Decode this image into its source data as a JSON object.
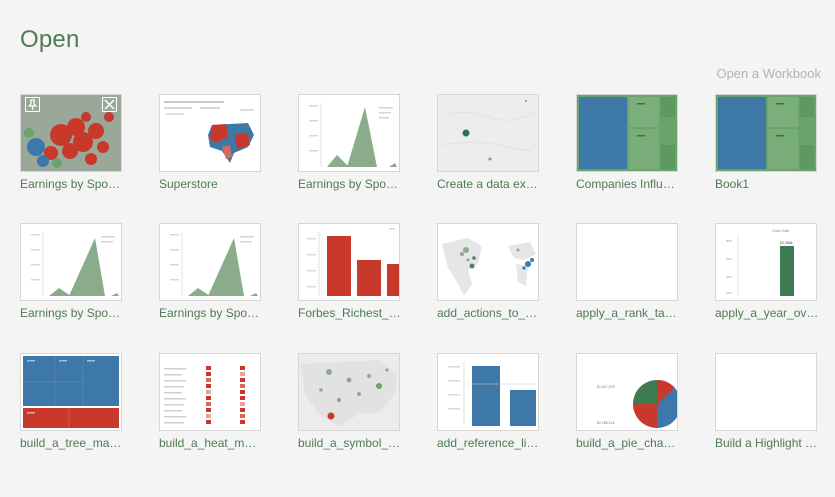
{
  "header": {
    "title": "Open",
    "open_workbook": "Open a Workbook"
  },
  "workbooks": [
    {
      "label": "Earnings by Spo…",
      "thumb": "bubbles-hover"
    },
    {
      "label": "Superstore",
      "thumb": "map-dashboard"
    },
    {
      "label": "Earnings by Spo…",
      "thumb": "area-peak"
    },
    {
      "label": "Create a data ex…",
      "thumb": "map-dots"
    },
    {
      "label": "Companies Influ…",
      "thumb": "treemap-blue-green"
    },
    {
      "label": "Book1",
      "thumb": "treemap-blue-green"
    },
    {
      "label": "Earnings by Spo…",
      "thumb": "area-peak"
    },
    {
      "label": "Earnings by Spo…",
      "thumb": "area-peak"
    },
    {
      "label": "Forbes_Richest_…",
      "thumb": "bar-red"
    },
    {
      "label": "add_actions_to_…",
      "thumb": "map-world"
    },
    {
      "label": "apply_a_rank_ta…",
      "thumb": "blank"
    },
    {
      "label": "apply_a_year_ov…",
      "thumb": "single-bar"
    },
    {
      "label": "build_a_tree_ma…",
      "thumb": "treemap-blue-red"
    },
    {
      "label": "build_a_heat_m…",
      "thumb": "heatmap-table"
    },
    {
      "label": "build_a_symbol_…",
      "thumb": "map-symbols"
    },
    {
      "label": "add_reference_li…",
      "thumb": "bar-blue"
    },
    {
      "label": "build_a_pie_cha…",
      "thumb": "pie"
    },
    {
      "label": "Build a Highlight …",
      "thumb": "blank"
    }
  ],
  "thumb_text": {
    "single_bar_title": "Order Date",
    "single_bar_value": "$2,358k",
    "single_bar_ticks": [
      "80%",
      "60%",
      "40%",
      "20%"
    ],
    "pie_value_top": "$1,017,275",
    "pie_value_bottom": "$2,185,144"
  },
  "colors": {
    "accent_green": "#4f7a54",
    "tableau_blue": "#3e78a8",
    "tableau_green": "#6aa36b",
    "tableau_red": "#c8392b",
    "muted_green": "#8aac8b"
  }
}
